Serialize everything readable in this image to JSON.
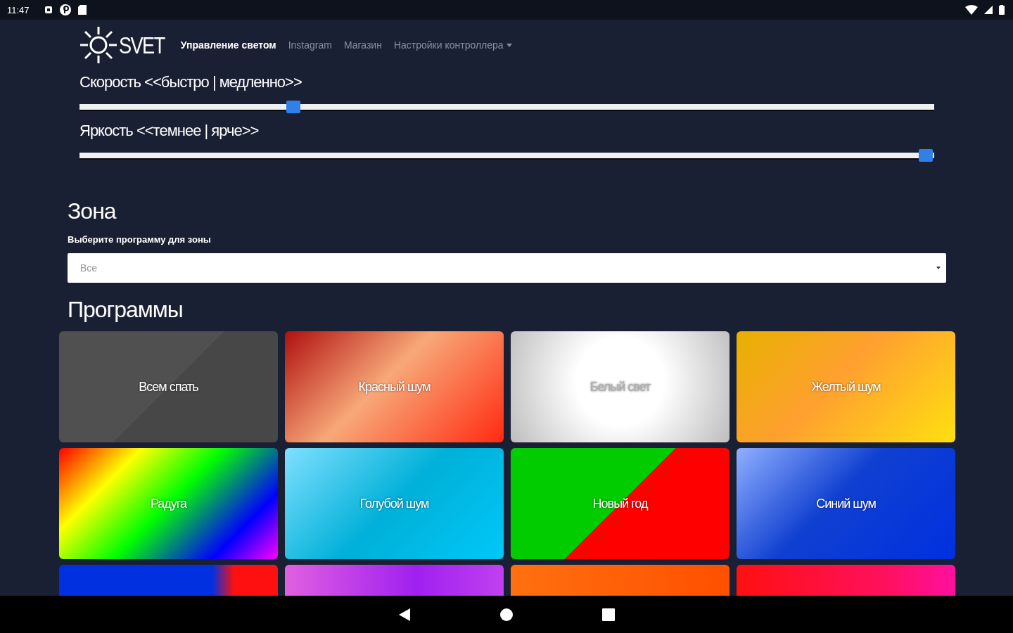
{
  "status_bar": {
    "time": "11:47"
  },
  "navbar": {
    "brand": "SVET",
    "links": [
      {
        "label": "Управление светом",
        "selected": true
      },
      {
        "label": "Instagram",
        "selected": false
      },
      {
        "label": "Магазин",
        "selected": false
      },
      {
        "label": "Настройки контроллера",
        "selected": false,
        "dropdown": true
      }
    ]
  },
  "sliders": [
    {
      "label": "Скорость <<быстро | медленно>>",
      "level": 0.25
    },
    {
      "label": "Яркость <<темнее | ярче>>",
      "level": 0.99
    }
  ],
  "zone": {
    "title": "Зона",
    "field_label": "Выберите программу для зоны",
    "select_value": "Все"
  },
  "programs": {
    "title": "Программы",
    "items": [
      {
        "label": "Всем спать",
        "kind": "grey"
      },
      {
        "label": "Красный шум",
        "kind": "red"
      },
      {
        "label": "Белый свет",
        "kind": "white"
      },
      {
        "label": "Желтый шум",
        "kind": "yellow"
      },
      {
        "label": "Радуга",
        "kind": "rainbow"
      },
      {
        "label": "Голубой шум",
        "kind": "cyan"
      },
      {
        "label": "Новый год",
        "kind": "newyear"
      },
      {
        "label": "Синий шум",
        "kind": "blue"
      },
      {
        "kind": "bluered"
      },
      {
        "kind": "violet"
      },
      {
        "kind": "orange"
      },
      {
        "kind": "redpink"
      }
    ]
  }
}
